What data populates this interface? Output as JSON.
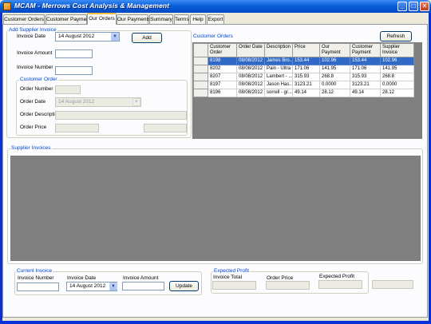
{
  "window": {
    "title": "MCAM - Merrows Cost Analysis & Management"
  },
  "tabs": [
    {
      "label": "Customer Orders"
    },
    {
      "label": "Customer Payments"
    },
    {
      "label": "Our Orders"
    },
    {
      "label": "Our Payments"
    },
    {
      "label": "Summary"
    },
    {
      "label": "Terms"
    },
    {
      "label": "Help"
    },
    {
      "label": "Export"
    }
  ],
  "active_tab": "Our Orders",
  "add_supplier_invoice": {
    "title": "Add Supplier Invoice",
    "invoice_date_label": "Invoice Date",
    "invoice_date_value": "14   August   2012",
    "add_button": "Add",
    "invoice_amount_label": "Invoice Amount",
    "invoice_amount_value": "",
    "invoice_number_label": "Invoice Number",
    "invoice_number_value": ""
  },
  "customer_order_box": {
    "title": "Customer Order",
    "order_number_label": "Order Number",
    "order_date_label": "Order Date",
    "order_date_value": "14   August   2012",
    "order_description_label": "Order Description",
    "order_price_label": "Order Price"
  },
  "customer_orders": {
    "title": "Customer Orders",
    "refresh_button": "Refresh",
    "columns": [
      "Customer Order",
      "Order Date",
      "Description",
      "Price",
      "Our Payment",
      "Customer Payment",
      "Supplier Invoice"
    ],
    "rows": [
      [
        "8198",
        "08/08/2012",
        "James Bro...",
        "153.44",
        "102.96",
        "153.44",
        "102.96"
      ],
      [
        "8202",
        "08/08/2012",
        "Pain - Ultra",
        "171.06",
        "141.95",
        "171.06",
        "141.95"
      ],
      [
        "8207",
        "08/08/2012",
        "Lambert - ...",
        "315.93",
        "268.8",
        "315.93",
        "268.8"
      ],
      [
        "8197",
        "08/08/2012",
        "Jason Has...",
        "3123.21",
        "0.0000",
        "3123.21",
        "0.0000"
      ],
      [
        "8196",
        "08/08/2012",
        "sorrell - gr...",
        "49.14",
        "28.12",
        "49.14",
        "28.12"
      ]
    ],
    "selected_row": 0
  },
  "supplier_invoices": {
    "title": "Supplier Invoices"
  },
  "current_invoice": {
    "title": "Current Invoice",
    "invoice_number_label": "Invoice Number",
    "invoice_number_value": "",
    "invoice_date_label": "Invoice Date",
    "invoice_date_value": "14   August   2012",
    "invoice_amount_label": "Invoice Amount",
    "invoice_amount_value": "",
    "update_button": "Update"
  },
  "expected_profit": {
    "title": "Expected Profit",
    "invoice_total_label": "Invoice Total",
    "order_price_label": "Order Price",
    "expected_profit_label": "Expected Profit"
  },
  "colors": {
    "titlebar": "#0a5fd8",
    "accent_label": "#0046d5",
    "selection": "#3169c6",
    "grid_empty": "#808080"
  }
}
